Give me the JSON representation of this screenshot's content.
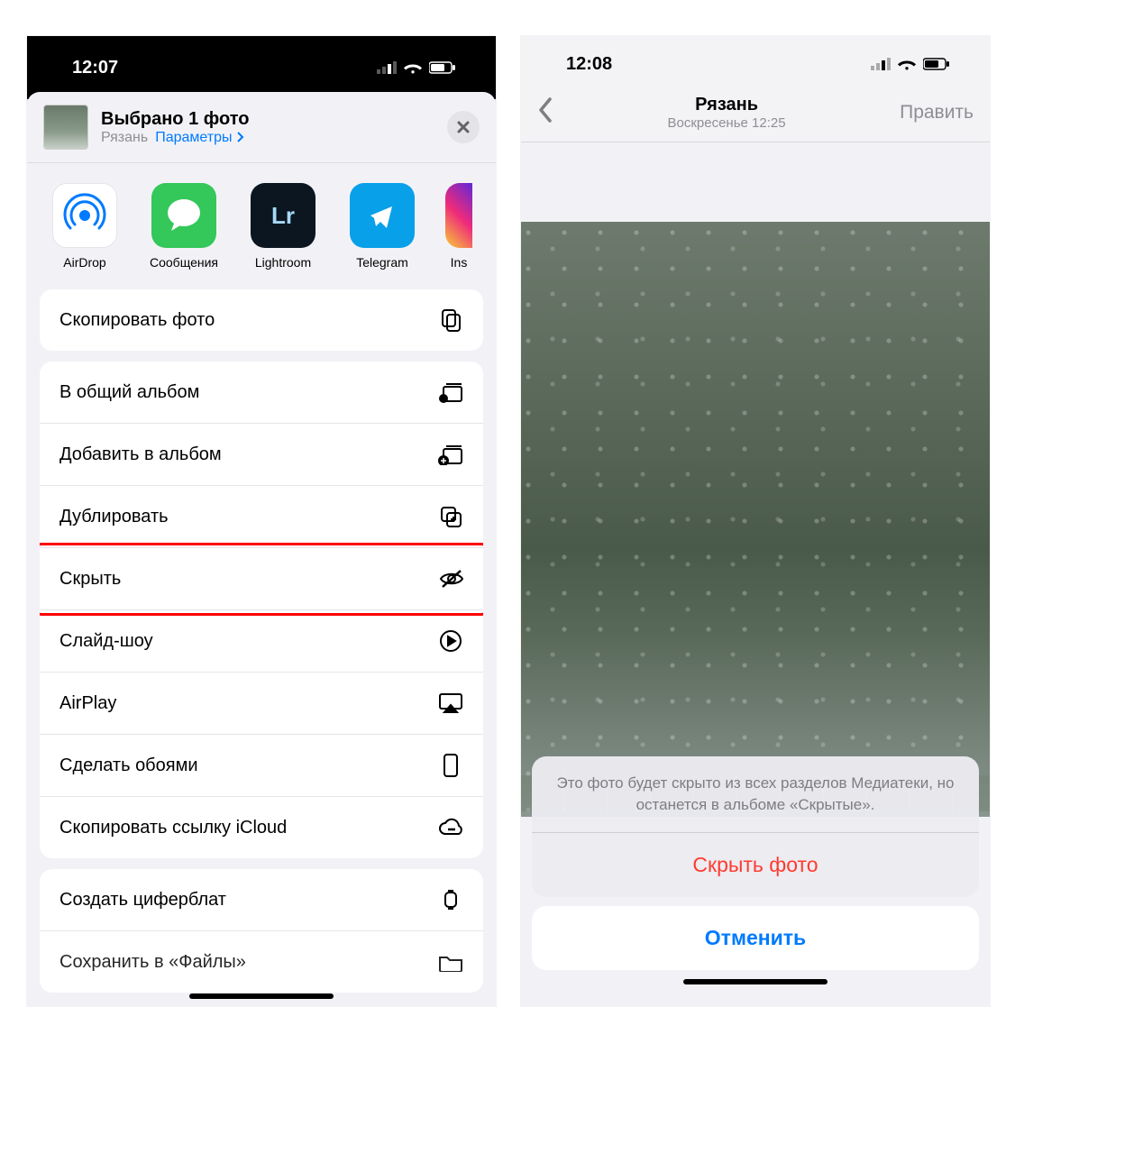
{
  "left": {
    "status_time": "12:07",
    "header": {
      "title": "Выбрано 1 фото",
      "subtitle_loc": "Рязань",
      "subtitle_params": "Параметры"
    },
    "apps": [
      {
        "name": "airdrop",
        "label": "AirDrop"
      },
      {
        "name": "messages",
        "label": "Сообщения"
      },
      {
        "name": "lightroom",
        "label": "Lightroom"
      },
      {
        "name": "telegram",
        "label": "Telegram"
      },
      {
        "name": "instagram",
        "label": "Ins"
      }
    ],
    "actions": {
      "copy_photo": "Скопировать фото",
      "shared_album": "В общий альбом",
      "add_album": "Добавить в альбом",
      "duplicate": "Дублировать",
      "hide": "Скрыть",
      "slideshow": "Слайд-шоу",
      "airplay": "AirPlay",
      "wallpaper": "Сделать обоями",
      "icloud_link": "Скопировать ссылку iCloud",
      "watchface": "Создать циферблат",
      "save_files": "Сохранить в «Файлы»"
    }
  },
  "right": {
    "status_time": "12:08",
    "nav": {
      "title": "Рязань",
      "subtitle": "Воскресенье  12:25",
      "edit": "Править"
    },
    "sheet": {
      "message": "Это фото будет скрыто из всех разделов Медиатеки, но останется в альбоме «Скрытые».",
      "hide_btn": "Скрыть фото",
      "cancel_btn": "Отменить"
    }
  }
}
